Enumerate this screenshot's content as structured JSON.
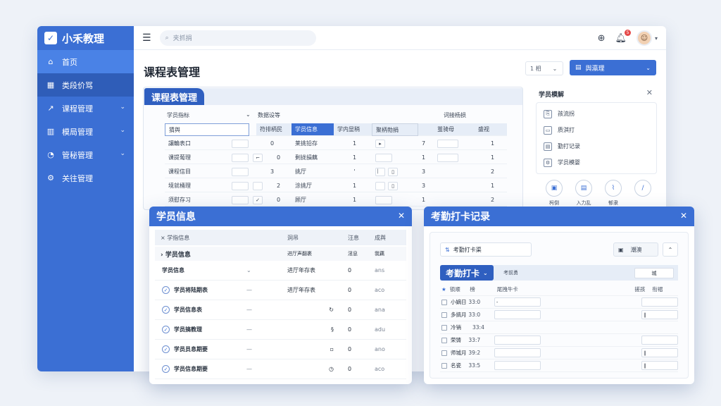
{
  "brand": {
    "name": "小禾教理",
    "logo": "✓"
  },
  "sidebar": {
    "items": [
      {
        "label": "首页",
        "icon": "home-icon",
        "glyph": "⌂"
      },
      {
        "label": "类段价骂",
        "icon": "grid-icon",
        "glyph": "▦"
      },
      {
        "label": "课程管理",
        "icon": "chart-icon",
        "glyph": "↗"
      },
      {
        "label": "模局管理",
        "icon": "bar-chart-icon",
        "glyph": "▥"
      },
      {
        "label": "管秘管理",
        "icon": "pie-icon",
        "glyph": "◔"
      },
      {
        "label": "关往管理",
        "icon": "gear-icon",
        "glyph": "⚙"
      }
    ]
  },
  "topbar": {
    "search_placeholder": "夹抓捐",
    "badge": "5"
  },
  "page": {
    "title": "课程表管理",
    "select_small": "1 相",
    "select_blue": "舆瀛理"
  },
  "schedule": {
    "tab": "课程表管理",
    "col1_label": "学员指标",
    "col2_label": "数据设等",
    "col3_label": "词接杨损",
    "header": [
      "猜舆",
      "符排柄民",
      "学员信息",
      "学内显稍",
      "聚柄勃捐",
      "",
      "茧骑母",
      "盛视"
    ],
    "rows": [
      {
        "name": "讓輪表口",
        "v1": "0",
        "v2": "莱挑铅存",
        "v3": "1",
        "v4": "7",
        "v5": "1"
      },
      {
        "name": "课提葡理",
        "v1": "0",
        "v2": "剩拢損藕",
        "v3": "1",
        "v4": "1",
        "v5": "1"
      },
      {
        "name": "课程信目",
        "v1": "3",
        "v2": "挑厅",
        "v3": "'",
        "v4": "3",
        "v5": "2"
      },
      {
        "name": "境就桶理",
        "v1": "2",
        "v2": "涂挑厅",
        "v3": "1",
        "v4": "3",
        "v5": "1"
      },
      {
        "name": "须慰存习",
        "v1": "0",
        "v2": "顾厅",
        "v3": "1",
        "v4": "1",
        "v5": "2"
      }
    ]
  },
  "side_panel": {
    "title": "学员模解",
    "items": [
      {
        "label": "孩流拐",
        "icon": "users-icon",
        "glyph": "⎘"
      },
      {
        "label": "质淇打",
        "icon": "card-icon",
        "glyph": "▭"
      },
      {
        "label": "勤打记录",
        "icon": "doc-icon",
        "glyph": "▤"
      },
      {
        "label": "学员模婴",
        "icon": "gear-icon",
        "glyph": "⚙"
      }
    ],
    "circles": [
      {
        "label": "枵倒",
        "icon": "image-icon",
        "glyph": "▣"
      },
      {
        "label": "入力乱",
        "icon": "file-icon",
        "glyph": "▤"
      },
      {
        "label": "郁隶",
        "icon": "bookmark-icon",
        "glyph": "⌇"
      },
      {
        "label": "",
        "icon": "pen-icon",
        "glyph": "∕"
      }
    ]
  },
  "students": {
    "title": "学员信息",
    "header": [
      "学指信息",
      "洞吊",
      "汪息",
      "成舆"
    ],
    "sub": "学员信息",
    "sub_cols": [
      "进厅声翻裹",
      "淫息",
      "我藕"
    ],
    "rows": [
      {
        "name": "学员信息",
        "stat": "进厅年存表",
        "n": "0",
        "op": "ans"
      },
      {
        "name": "学员将陆期表",
        "stat": "进厅年存表",
        "n": "0",
        "op": "aco"
      },
      {
        "name": "学员信息表",
        "stat": "",
        "n": "0",
        "op": "ana"
      },
      {
        "name": "学员搞教理",
        "stat": "",
        "n": "0",
        "op": "adu"
      },
      {
        "name": "学员员息期要",
        "stat": "",
        "n": "0",
        "op": "ano"
      },
      {
        "name": "学员信息期要",
        "stat": "",
        "n": "0",
        "op": "aco"
      }
    ]
  },
  "attendance": {
    "title": "考勤打卡记录",
    "input": "考勤打卡渠",
    "btn": "潮澳",
    "tab": "考勤打卡",
    "label": "考前勇",
    "mini": "城",
    "header": [
      "锁顺",
      "榜",
      "尾拽牛卡",
      "搓孩",
      "衔褶"
    ],
    "rows": [
      {
        "name": "小嫡日",
        "time": "33:0",
        "box": "‐",
        "right": ""
      },
      {
        "name": "多搞月",
        "time": "33:0",
        "box": "",
        "right": "∥"
      },
      {
        "name": "冷销",
        "time": "33:4",
        "box": "",
        "right": ""
      },
      {
        "name": "荣铸",
        "time": "33:7",
        "box": "",
        "right": ""
      },
      {
        "name": "师城月",
        "time": "39:2",
        "box": "",
        "right": "∥"
      },
      {
        "name": "名瓷",
        "time": "33:5",
        "box": "",
        "right": "∥"
      }
    ]
  }
}
